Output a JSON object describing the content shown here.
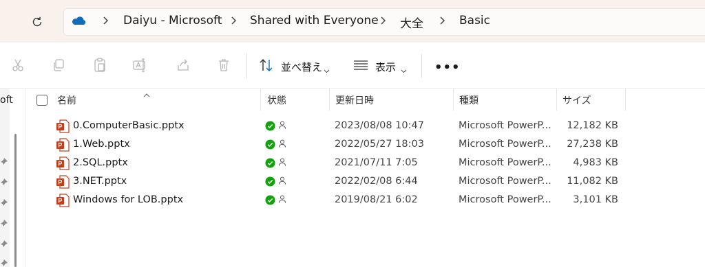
{
  "breadcrumb": {
    "cloud_icon": "onedrive-cloud-icon",
    "items": [
      "Daiyu - Microsoft",
      "Shared with Everyone",
      "大全",
      "Basic"
    ]
  },
  "toolbar": {
    "sort_label": "並べ替え",
    "view_label": "表示",
    "more_label": "•••"
  },
  "nav": {
    "partial_text": "oft"
  },
  "columns": {
    "name": "名前",
    "status": "状態",
    "modified": "更新日時",
    "type": "種類",
    "size": "サイズ"
  },
  "files": [
    {
      "name": "0.ComputerBasic.pptx",
      "modified": "2023/08/08 10:47",
      "type": "Microsoft PowerP...",
      "size": "12,182 KB"
    },
    {
      "name": "1.Web.pptx",
      "modified": "2022/05/27 18:03",
      "type": "Microsoft PowerP...",
      "size": "27,238 KB"
    },
    {
      "name": "2.SQL.pptx",
      "modified": "2021/07/11 7:05",
      "type": "Microsoft PowerP...",
      "size": "4,983 KB"
    },
    {
      "name": "3.NET.pptx",
      "modified": "2022/02/08 6:44",
      "type": "Microsoft PowerP...",
      "size": "11,082 KB"
    },
    {
      "name": "Windows for LOB.pptx",
      "modified": "2019/08/21 6:02",
      "type": "Microsoft PowerP...",
      "size": "3,101 KB"
    }
  ],
  "colors": {
    "accent_blue": "#0f6cbd",
    "status_green": "#13a10e",
    "ppt_red": "#c43e1c"
  }
}
